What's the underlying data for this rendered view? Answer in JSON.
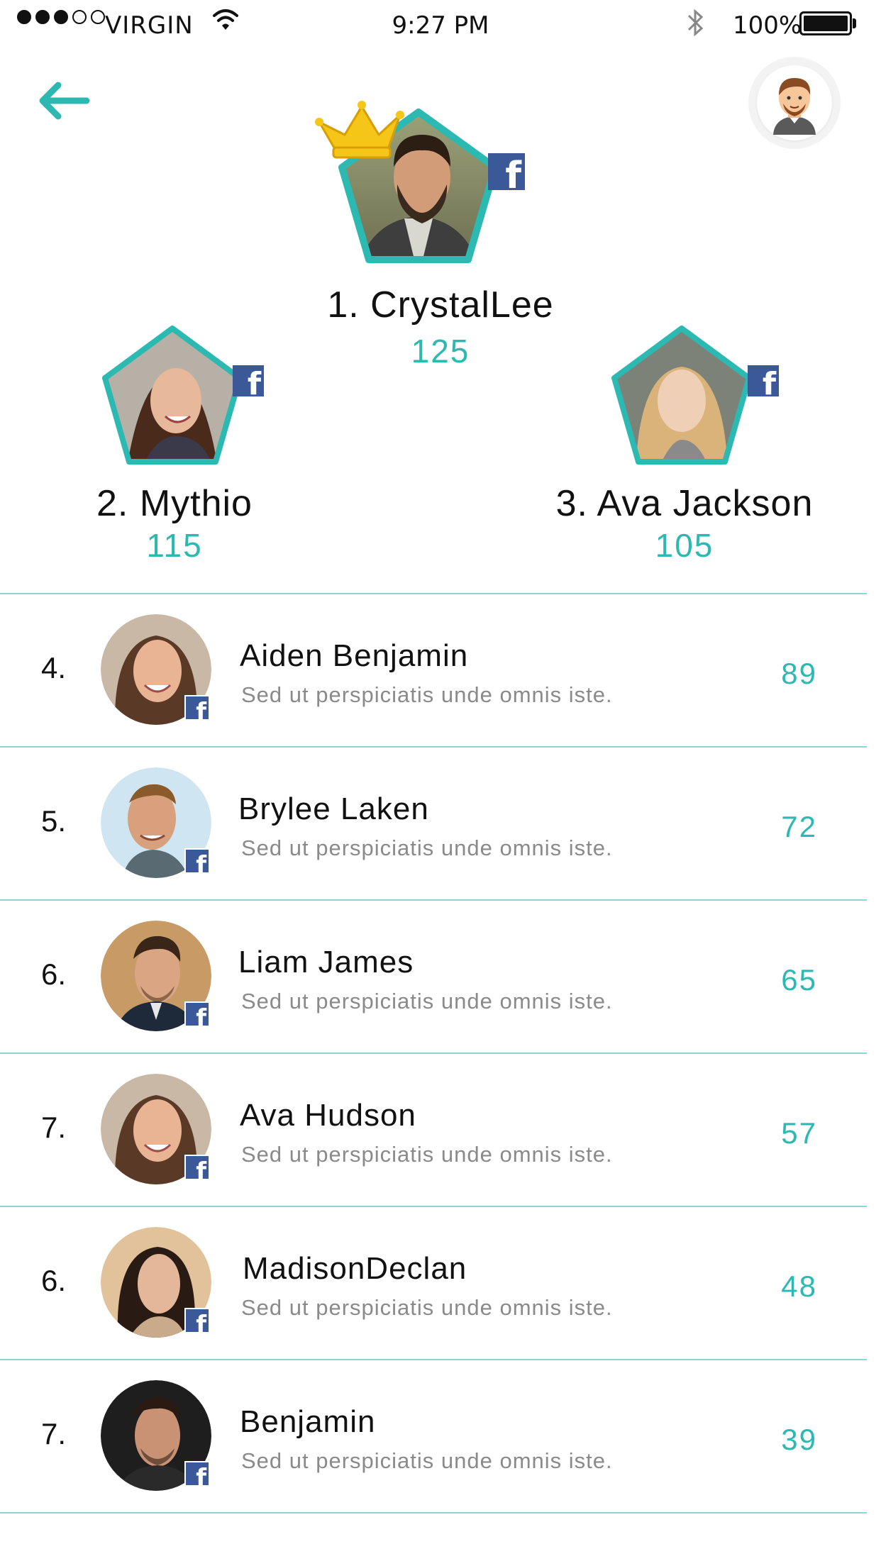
{
  "status_bar": {
    "carrier": "VIRGIN",
    "time": "9:27 PM",
    "battery": "100%"
  },
  "colors": {
    "accent": "#2bb9b2",
    "divider": "#8ad6d4",
    "facebook": "#3b5998",
    "crown": "#f5c518"
  },
  "header": {
    "back_icon": "arrow-left-icon",
    "profile_icon": "user-avatar-icon"
  },
  "podium": [
    {
      "name": "1. CrystalLee",
      "score": "125",
      "badge": "f"
    },
    {
      "name": "2. Mythio",
      "score": "115",
      "badge": "f"
    },
    {
      "name": "3. Ava Jackson",
      "score": "105",
      "badge": "f"
    }
  ],
  "list": [
    {
      "rank": "4.",
      "name": "Aiden Benjamin",
      "subtitle": "Sed ut perspiciatis unde omnis iste.",
      "score": "89",
      "badge": "f"
    },
    {
      "rank": "5.",
      "name": "Brylee Laken",
      "subtitle": "Sed ut perspiciatis unde omnis iste.",
      "score": "72",
      "badge": "f"
    },
    {
      "rank": "6.",
      "name": "Liam James",
      "subtitle": "Sed ut perspiciatis unde omnis iste.",
      "score": "65",
      "badge": "f"
    },
    {
      "rank": "7.",
      "name": "Ava Hudson",
      "subtitle": "Sed ut perspiciatis unde omnis iste.",
      "score": "57",
      "badge": "f"
    },
    {
      "rank": "6.",
      "name": "MadisonDeclan",
      "subtitle": "Sed ut perspiciatis unde omnis iste.",
      "score": "48",
      "badge": "f"
    },
    {
      "rank": "7.",
      "name": "Benjamin",
      "subtitle": "Sed ut perspiciatis unde omnis iste.",
      "score": "39",
      "badge": "f"
    }
  ]
}
